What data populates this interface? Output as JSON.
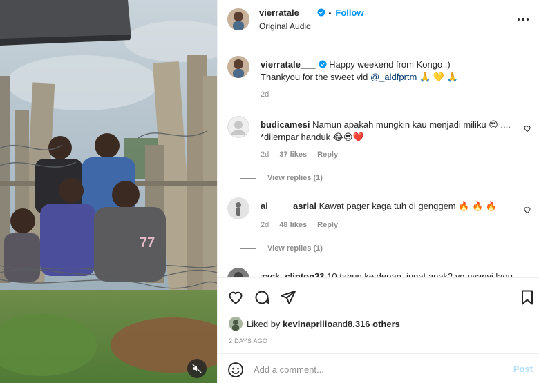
{
  "post": {
    "username": "vierratale___",
    "follow_label": "Follow",
    "separator": "•",
    "audio": "Original Audio",
    "caption_line1": "Happy weekend from Kongo ;)",
    "caption_line2_text": "Thankyou for the sweet vid ",
    "caption_mention": "@_aldfprtm",
    "caption_emoji": "🙏 💛 🙏",
    "caption_time": "2d"
  },
  "comments": [
    {
      "username": "budicamesi",
      "text": "Namun apakah mungkin kau menjadi miliku 😍 .... *dilempar handuk 😂😎❤️",
      "time": "2d",
      "likes": "37 likes",
      "reply": "Reply",
      "view_replies": "View replies (1)"
    },
    {
      "username": "al_____asrial",
      "text": "Kawat pager kaga tuh di genggem 🔥 🔥 🔥",
      "time": "2d",
      "likes": "48 likes",
      "reply": "Reply",
      "view_replies": "View replies (1)"
    },
    {
      "username": "zack_clinton23",
      "text": "10 tahun ke depan, ingat anak2 yg nyanyi lagu"
    }
  ],
  "likes_summary": {
    "prefix": "Liked by ",
    "user": "kevinaprilio",
    "middle": " and ",
    "count": "8,316 others"
  },
  "date": "2 DAYS AGO",
  "composer": {
    "placeholder": "Add a comment...",
    "post_label": "Post"
  },
  "icons": {
    "like": "heart-icon",
    "comment": "comment-icon",
    "share": "paper-plane-icon",
    "save": "bookmark-icon",
    "mute": "speaker-muted-icon",
    "more": "more-options-icon",
    "emoji": "emoji-icon",
    "verified": "verified-badge-icon"
  },
  "colors": {
    "accent": "#0095f6",
    "mention": "#00376b",
    "secondary_text": "#8e8e8e",
    "post_disabled": "#b2dffc"
  }
}
